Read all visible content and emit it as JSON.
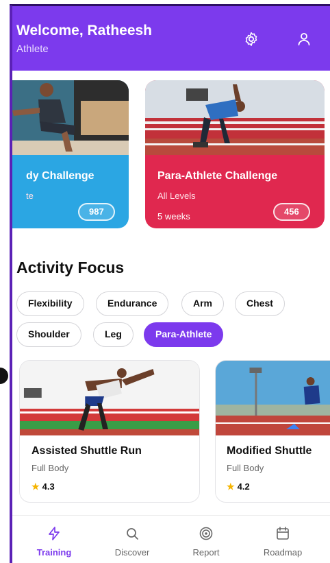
{
  "header": {
    "welcome": "Welcome, Ratheesh",
    "role": "Athlete",
    "settings_icon": "gear-icon",
    "profile_icon": "user-icon"
  },
  "challenges": [
    {
      "title": "dy Challenge",
      "level": "te",
      "weeks": "",
      "count": "987",
      "color": "#2ba6e3"
    },
    {
      "title": "Para-Athlete Challenge",
      "level": "All Levels",
      "weeks": "5 weeks",
      "count": "456",
      "color": "#e0284f"
    }
  ],
  "activity_focus": {
    "title": "Activity Focus",
    "chips": [
      "Flexibility",
      "Endurance",
      "Arm",
      "Chest",
      "Shoulder",
      "Leg",
      "Para-Athlete"
    ],
    "active_chip": "Para-Athlete"
  },
  "activities": [
    {
      "title": "Assisted Shuttle Run",
      "category": "Full Body",
      "rating": "4.3"
    },
    {
      "title": "Modified Shuttle",
      "category": "Full Body",
      "rating": "4.2"
    }
  ],
  "nav": [
    {
      "label": "Training",
      "icon": "lightning-icon",
      "active": true
    },
    {
      "label": "Discover",
      "icon": "search-icon",
      "active": false
    },
    {
      "label": "Report",
      "icon": "target-icon",
      "active": false
    },
    {
      "label": "Roadmap",
      "icon": "calendar-icon",
      "active": false
    }
  ],
  "colors": {
    "primary": "#7c3aed",
    "blue_card": "#2ba6e3",
    "red_card": "#e0284f",
    "star": "#f5b400"
  }
}
